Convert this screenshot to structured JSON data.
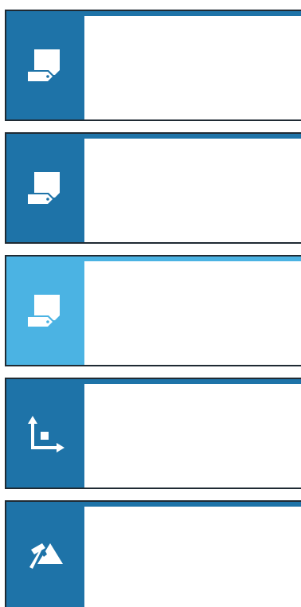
{
  "cards": [
    {
      "icon": "tag-document-icon",
      "state": "default"
    },
    {
      "icon": "tag-document-icon",
      "state": "default"
    },
    {
      "icon": "tag-document-icon",
      "state": "highlighted"
    },
    {
      "icon": "axes-point-icon",
      "state": "default"
    },
    {
      "icon": "hammer-mountain-icon",
      "state": "default"
    }
  ],
  "colors": {
    "panel": "#1e73a8",
    "panel_highlighted": "#4bb3e3",
    "border": "#1f2a33",
    "body": "#ffffff"
  }
}
